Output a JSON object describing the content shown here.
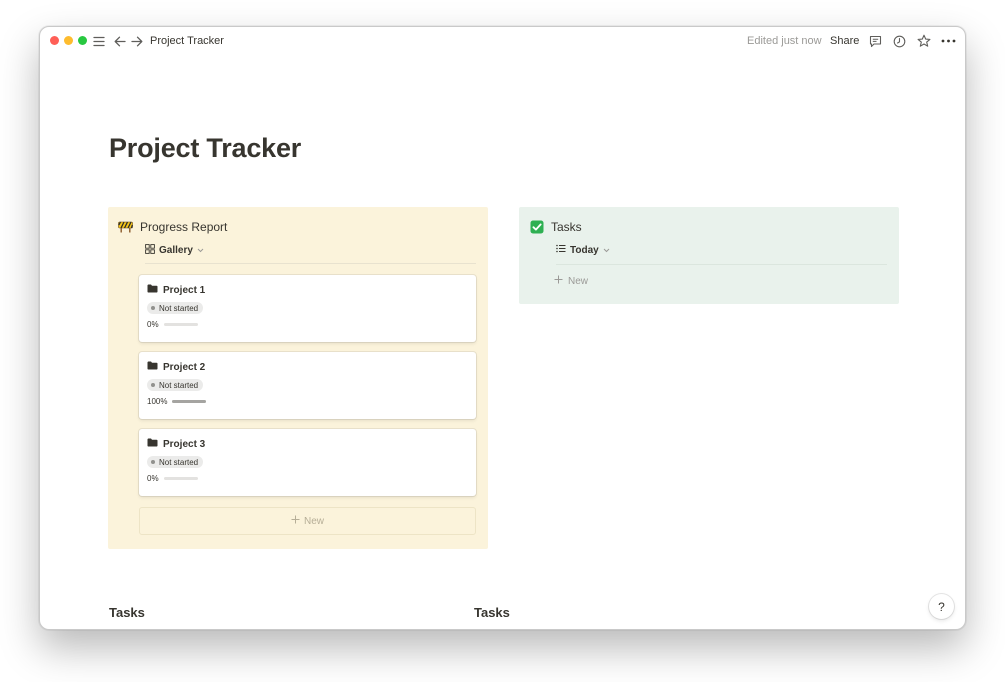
{
  "topbar": {
    "breadcrumb": "Project Tracker",
    "edited": "Edited just now",
    "share": "Share",
    "icons": [
      "sidebar-menu-icon",
      "back-arrow-icon",
      "forward-arrow-icon",
      "comment-icon",
      "history-clock-icon",
      "star-icon",
      "more-icon"
    ]
  },
  "page": {
    "title": "Project Tracker"
  },
  "progress_report": {
    "emoji": "construction-sign-icon",
    "title": "Progress Report",
    "view": "Gallery",
    "new_label": "New",
    "cards": [
      {
        "title": "Project 1",
        "status": "Not started",
        "progress_label": "0%",
        "progress": 0
      },
      {
        "title": "Project 2",
        "status": "Not started",
        "progress_label": "100%",
        "progress": 1
      },
      {
        "title": "Project 3",
        "status": "Not started",
        "progress_label": "0%",
        "progress": 0
      }
    ]
  },
  "tasks_callout": {
    "emoji": "checkmark-box-icon",
    "title": "Tasks",
    "view": "Today",
    "new_label": "New"
  },
  "sections": {
    "left_heading": "Tasks",
    "right_heading": "Tasks"
  },
  "help": "?",
  "colors": {
    "callout_yellow": "#fbf3db",
    "callout_green": "#e9f2ec",
    "checkbox_green": "#2eb052",
    "text": "#37352f",
    "muted": "#9b9a97"
  }
}
